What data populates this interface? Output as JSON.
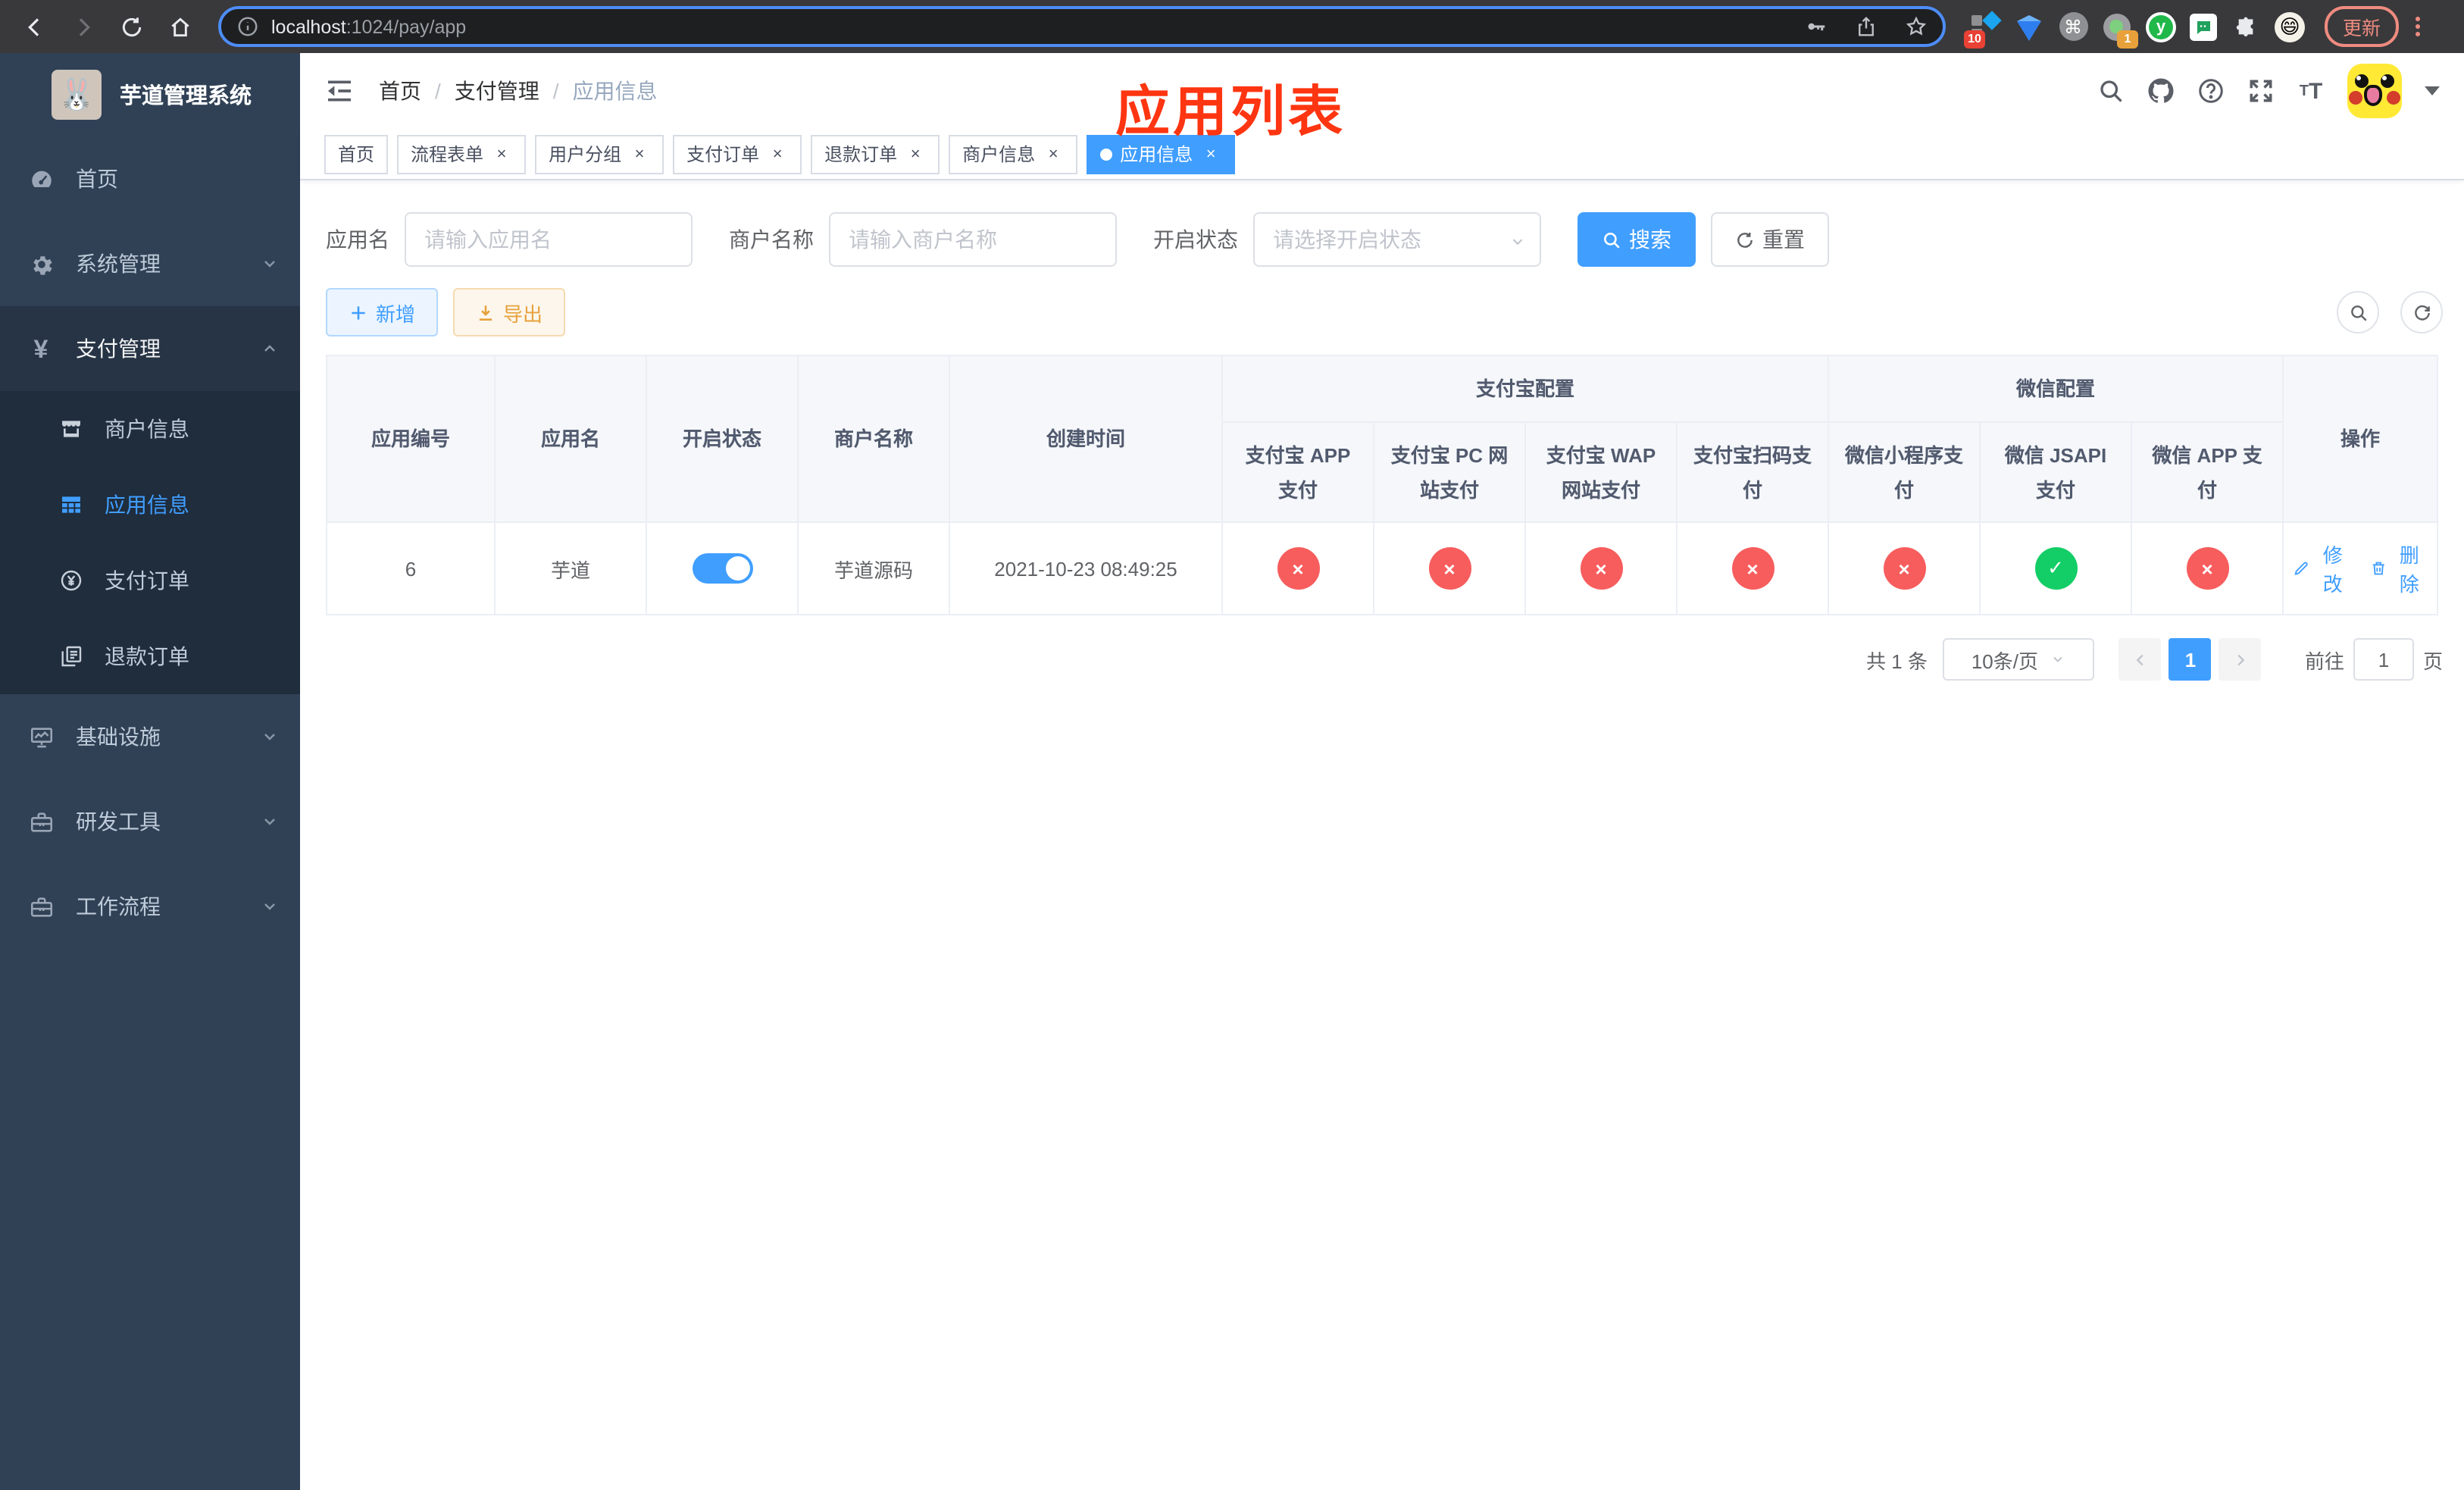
{
  "browser": {
    "url_host": "localhost",
    "url_path": ":1024/pay/app",
    "update_label": "更新",
    "ext_badge_ten": "10",
    "ext_badge_one": "1",
    "ext_y_label": "y"
  },
  "sidebar": {
    "title": "芋道管理系统",
    "items": [
      {
        "label": "首页"
      },
      {
        "label": "系统管理"
      },
      {
        "label": "支付管理"
      },
      {
        "label": "商户信息"
      },
      {
        "label": "应用信息"
      },
      {
        "label": "支付订单"
      },
      {
        "label": "退款订单"
      },
      {
        "label": "基础设施"
      },
      {
        "label": "研发工具"
      },
      {
        "label": "工作流程"
      }
    ]
  },
  "header": {
    "breadcrumb": [
      "首页",
      "支付管理",
      "应用信息"
    ],
    "annotation": "应用列表"
  },
  "tabs": [
    {
      "label": "首页"
    },
    {
      "label": "流程表单"
    },
    {
      "label": "用户分组"
    },
    {
      "label": "支付订单"
    },
    {
      "label": "退款订单"
    },
    {
      "label": "商户信息"
    },
    {
      "label": "应用信息"
    }
  ],
  "filters": {
    "app_name_label": "应用名",
    "app_name_placeholder": "请输入应用名",
    "merchant_label": "商户名称",
    "merchant_placeholder": "请输入商户名称",
    "status_label": "开启状态",
    "status_placeholder": "请选择开启状态",
    "search_label": "搜索",
    "reset_label": "重置"
  },
  "toolbar": {
    "add_label": "新增",
    "export_label": "导出"
  },
  "table": {
    "headers": {
      "id": "应用编号",
      "name": "应用名",
      "status": "开启状态",
      "merchant": "商户名称",
      "created": "创建时间",
      "alipay_group": "支付宝配置",
      "wechat_group": "微信配置",
      "alipay_app": "支付宝 APP 支付",
      "alipay_pc": "支付宝 PC 网站支付",
      "alipay_wap": "支付宝 WAP 网站支付",
      "alipay_qr": "支付宝扫码支付",
      "wechat_lite": "微信小程序支付",
      "wechat_jsapi": "微信 JSAPI 支付",
      "wechat_app": "微信 APP 支付",
      "actions": "操作"
    },
    "row": {
      "id": "6",
      "name": "芋道",
      "enabled": true,
      "merchant": "芋道源码",
      "created": "2021-10-23 08:49:25",
      "pay_statuses": [
        false,
        false,
        false,
        false,
        false,
        true,
        false
      ]
    },
    "row_actions": {
      "edit": "修改",
      "delete": "删除"
    }
  },
  "pagination": {
    "total": "共 1 条",
    "page_size": "10条/页",
    "current_page": "1",
    "goto_label": "前往",
    "goto_value": "1",
    "page_suffix": "页"
  },
  "colors": {
    "primary": "#409eff",
    "success": "#13ce66",
    "danger": "#f75d5d",
    "warning": "#e6a23c",
    "sidebar_bg": "#304156",
    "submenu_bg": "#1f2d3d",
    "annotation_red": "#fe3511"
  }
}
